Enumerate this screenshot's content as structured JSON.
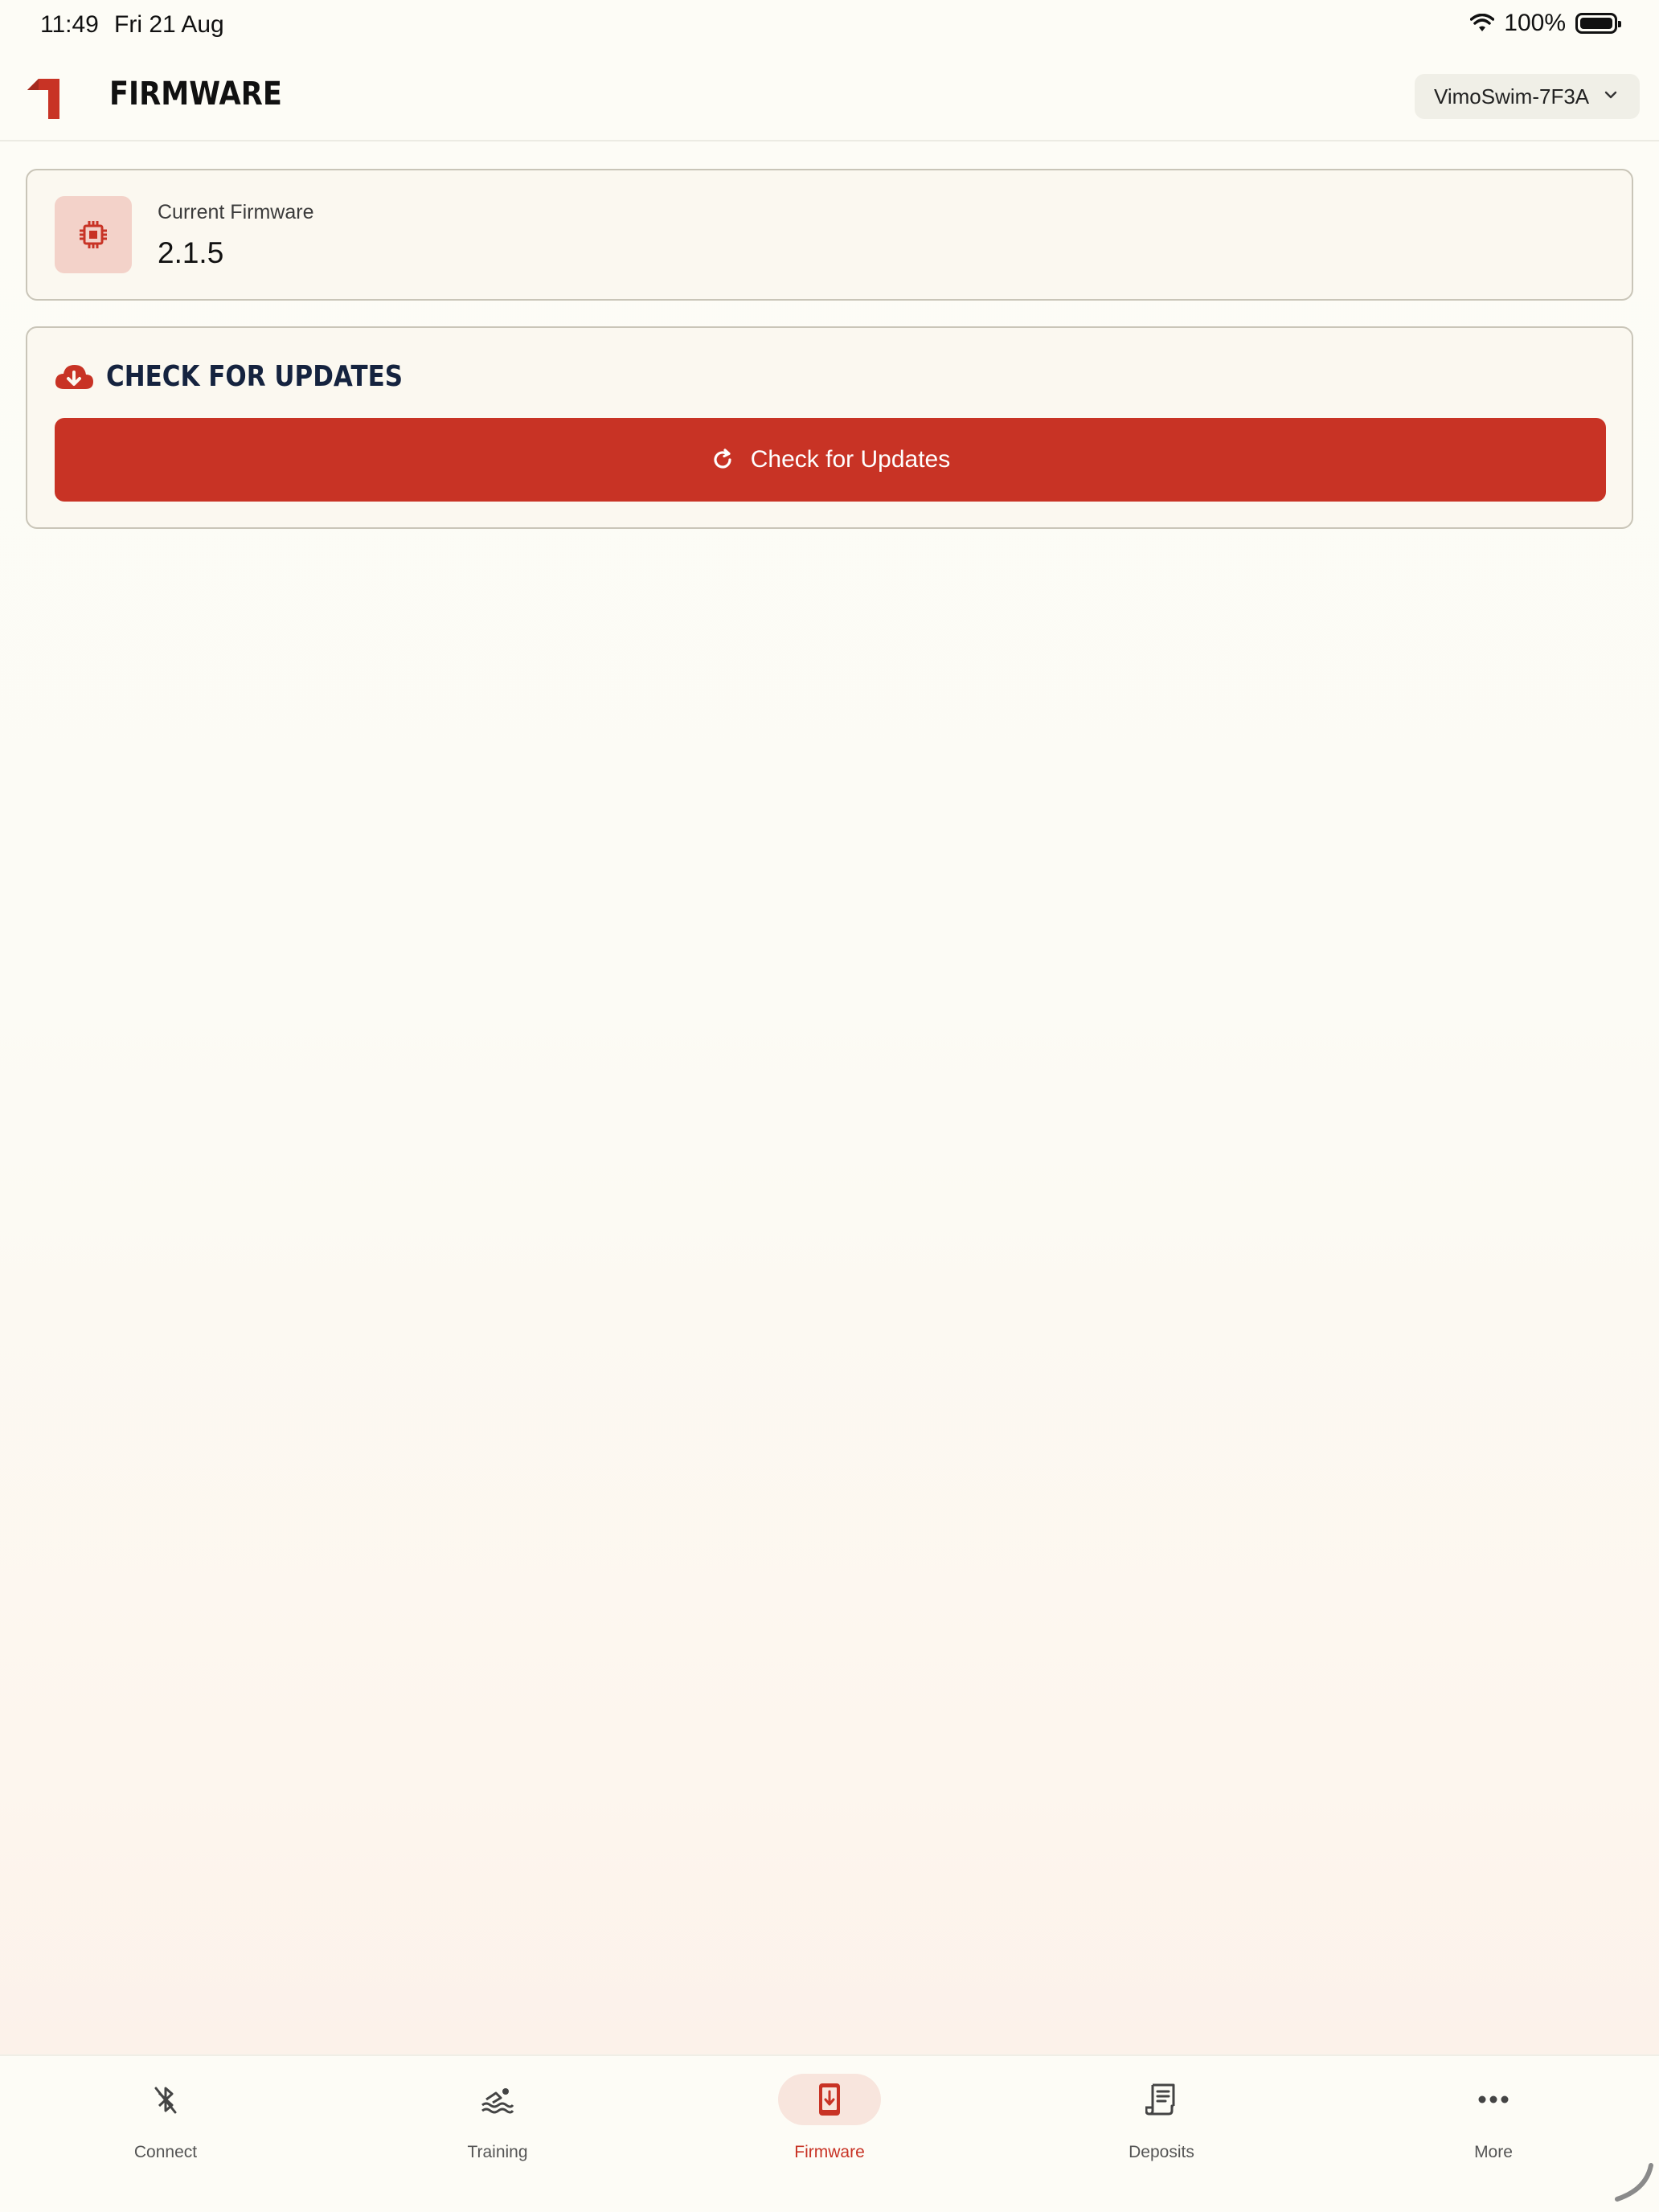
{
  "status_bar": {
    "time": "11:49",
    "date": "Fri 21 Aug",
    "battery": "100%"
  },
  "header": {
    "title": "FIRMWARE",
    "device": "VimoSwim-7F3A"
  },
  "firmware_card": {
    "label": "Current Firmware",
    "version": "2.1.5"
  },
  "updates_card": {
    "title": "CHECK FOR UPDATES",
    "button_label": "Check for Updates"
  },
  "tabs": [
    {
      "label": "Connect",
      "icon": "bluetooth-off-icon"
    },
    {
      "label": "Training",
      "icon": "swimmer-icon"
    },
    {
      "label": "Firmware",
      "icon": "device-download-icon",
      "active": true
    },
    {
      "label": "Deposits",
      "icon": "receipt-icon"
    },
    {
      "label": "More",
      "icon": "more-dots-icon"
    }
  ],
  "colors": {
    "accent": "#c83325",
    "title_navy": "#15233f",
    "background": "#fdfcf6"
  }
}
